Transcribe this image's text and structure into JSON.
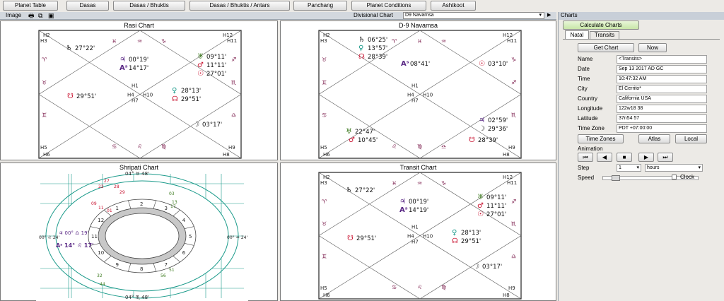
{
  "toolbar": {
    "buttons": [
      "Planet Table",
      "Dasas",
      "Dasas / Bhuktis",
      "Dasas / Bhuktis / Antars",
      "Panchang",
      "Planet Conditions",
      "Ashtkoot"
    ]
  },
  "subbar": {
    "image_label": "Image",
    "divisional_label": "Divisional Chart",
    "divisional_value": "D9 Navamsa"
  },
  "charts": {
    "rasi": {
      "title": "Rasi Chart",
      "houses": [
        "H1",
        "H2",
        "H3",
        "H4",
        "H5",
        "H6",
        "H7",
        "H8",
        "H9",
        "H10",
        "H11",
        "H12"
      ],
      "signs": [
        "♈",
        "♉",
        "♊",
        "♋",
        "♌",
        "♍",
        "♎",
        "♏",
        "♐",
        "♑",
        "♒",
        "♓"
      ],
      "planets": [
        [
          "♄",
          "27°22'"
        ],
        [
          "♃",
          "00°19'"
        ],
        [
          "Aˢ",
          "14°17'"
        ],
        [
          "♅",
          "09°11'"
        ],
        [
          "♂",
          "11°11'"
        ],
        [
          "☉",
          "27°01'"
        ],
        [
          "☋",
          "29°51'"
        ],
        [
          "♀",
          "28°13'"
        ],
        [
          "☊",
          "29°51'"
        ],
        [
          "☽",
          "03°17'"
        ]
      ]
    },
    "navamsa": {
      "title": "D-9 Navamsa",
      "planets": [
        [
          "♄",
          "06°25'"
        ],
        [
          "♀",
          "13°57'"
        ],
        [
          "☊",
          "28°39'"
        ],
        [
          "Aˢ",
          "08°41'"
        ],
        [
          "☉",
          "03°10'"
        ],
        [
          "♅",
          "22°47'"
        ],
        [
          "♂",
          "10°45'"
        ],
        [
          "♃",
          "02°59'"
        ],
        [
          "☽",
          "29°36'"
        ],
        [
          "☋",
          "28°39'"
        ]
      ]
    },
    "shripati": {
      "title": "Shripati Chart",
      "top": "04° ♉ 48'",
      "bottom": "04° ♏ 48'",
      "left": "00° ♌ 24'",
      "right": "00° ♒ 24'",
      "asc": "Aˢ 14° ♌ 17'",
      "ju": "♃ 00° ♎ 19'",
      "houses": [
        "1",
        "2",
        "3",
        "4",
        "5",
        "6",
        "7",
        "8",
        "9",
        "10",
        "11",
        "12"
      ],
      "planet_degrees": [
        "27",
        "22",
        "28",
        "29",
        "09",
        "11",
        "01",
        "03",
        "17",
        "13",
        "51",
        "56",
        "32",
        "44"
      ]
    },
    "transit": {
      "title": "Transit Chart",
      "planets": [
        [
          "♄",
          "27°22'"
        ],
        [
          "♃",
          "00°19'"
        ],
        [
          "Aˢ",
          "14°19'"
        ],
        [
          "♅",
          "09°11'"
        ],
        [
          "♂",
          "11°11'"
        ],
        [
          "☉",
          "27°01'"
        ],
        [
          "☋",
          "29°51'"
        ],
        [
          "♀",
          "28°13'"
        ],
        [
          "☊",
          "29°51'"
        ],
        [
          "☽",
          "03°17'"
        ]
      ]
    }
  },
  "side": {
    "header": "Charts",
    "calc_button": "Calculate Charts",
    "tabs": [
      "Natal",
      "Transits"
    ],
    "get_chart": "Get Chart",
    "now": "Now",
    "fields": [
      [
        "Name",
        "<Transits>"
      ],
      [
        "Date",
        "Sep 13 2017 AD GC"
      ],
      [
        "Time",
        "10:47:32 AM"
      ],
      [
        "City",
        "El Cerrito*"
      ],
      [
        "Country",
        "California USA"
      ],
      [
        "Longitude",
        "122w18 38"
      ],
      [
        "Latitude",
        "37n54 57"
      ],
      [
        "Time Zone",
        "PDT +07:00:00"
      ]
    ],
    "tz_button": "Time Zones",
    "atlas_button": "Atlas",
    "local_button": "Local",
    "animation_label": "Animation",
    "step_label": "Step",
    "step_value": "1",
    "step_unit": "hours",
    "speed_label": "Speed",
    "clock_label": "Clock"
  },
  "colors": {
    "sat": "#000000",
    "jup": "#5b2a86",
    "asc": "#5b2a86",
    "ura": "#3c7a1e",
    "mars": "#c8102e",
    "sun": "#c8102e",
    "ketu": "#c8102e",
    "ven": "#1a9a8a",
    "rahu": "#c8102e",
    "moon": "#333333"
  }
}
